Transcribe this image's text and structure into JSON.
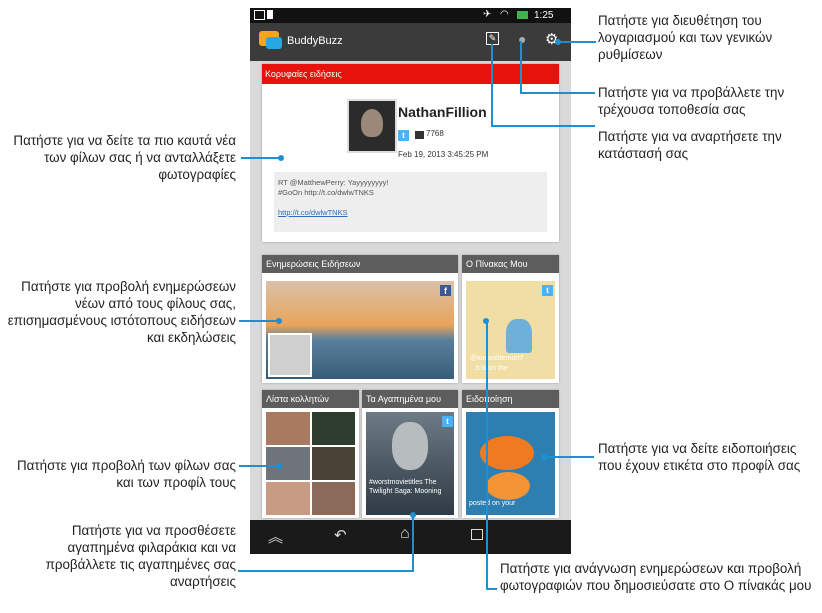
{
  "statusbar": {
    "time": "1:25"
  },
  "actionbar": {
    "app_title": "BuddyBuzz"
  },
  "top_news": {
    "header": "Κορυφαίες ειδήσεις",
    "user_name": "NathanFillion",
    "follower_count": "7768",
    "timestamp": "Feb 19, 2013 3:45:25 PM",
    "tweet_line1": "RT @MatthewPerry: Yayyyyyyyy!",
    "tweet_line2": "#GoOn http://t.co/dwlwTNKS",
    "tweet_link": "http://t.co/dwlwTNKS"
  },
  "tiles": {
    "news_updates": "Ενημερώσεις Ειδήσεων",
    "my_board": "Ο Πίνακας Μου",
    "my_board_caption_1": "@lordvoldemort7",
    "my_board_caption_2": "...it is on the",
    "buddy_list": "Λίστα κολλητών",
    "favorites": "Τα Αγαπημένα μου",
    "favorites_caption": "#worstmovietitles The Twilight Saga: Mooning",
    "notification": "Ειδοποίηση",
    "notification_caption": "posted on your"
  },
  "callouts": {
    "settings": "Πατήστε για διευθέτηση του λογαριασμού και των γενικών ρυθμίσεων",
    "location": "Πατήστε για να προβάλλετε την τρέχουσα τοποθεσία σας",
    "post_status": "Πατήστε για να αναρτήσετε την κατάστασή σας",
    "top_news": "Πατήστε για να δείτε τα πιο καυτά νέα των φίλων σας ή να ανταλλάξετε φωτογραφίες",
    "news_updates": "Πατήστε για προβολή ενημερώσεων νέων από τους φίλους σας, επισημασμένους ιστότοπους ειδήσεων και εκδηλώσεις",
    "buddy_list": "Πατήστε για προβολή των φίλων σας και των προφίλ τους",
    "favorites": "Πατήστε για να προσθέσετε αγαπημένα φιλαράκια και να προβάλλετε τις αγαπημένες σας αναρτήσεις",
    "notification": "Πατήστε για να δείτε ειδοποιήσεις που έχουν ετικέτα στο προφίλ σας",
    "my_board": "Πατήστε για ανάγνωση ενημερώσεων και προβολή φωτογραφιών που δημοσιεύσατε στο Ο πίνακάς μου"
  }
}
